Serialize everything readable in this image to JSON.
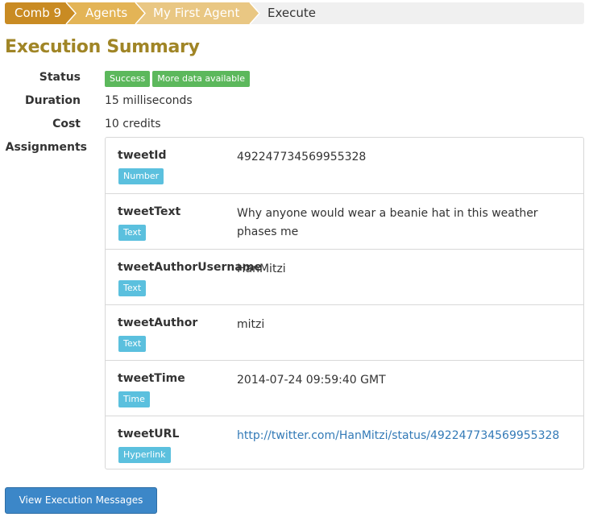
{
  "breadcrumb": {
    "items": [
      {
        "label": "Comb 9",
        "color": "#c98b23"
      },
      {
        "label": "Agents",
        "color": "#e3b456"
      },
      {
        "label": "My First Agent",
        "color": "#e9c783"
      },
      {
        "label": "Execute",
        "color": "#f0f0f0"
      }
    ]
  },
  "page": {
    "title": "Execution Summary"
  },
  "summary": {
    "status_label": "Status",
    "status_badges": [
      "Success",
      "More data available"
    ],
    "duration_label": "Duration",
    "duration_value": "15 milliseconds",
    "cost_label": "Cost",
    "cost_value": "10 credits",
    "assignments_label": "Assignments"
  },
  "assignments": [
    {
      "name": "tweetId",
      "type": "Number",
      "value": "492247734569955328"
    },
    {
      "name": "tweetText",
      "type": "Text",
      "value": "Why anyone would wear a beanie hat in this weather phases me"
    },
    {
      "name": "tweetAuthorUsername",
      "type": "Text",
      "value": "HanMitzi"
    },
    {
      "name": "tweetAuthor",
      "type": "Text",
      "value": "mitzi"
    },
    {
      "name": "tweetTime",
      "type": "Time",
      "value": "2014-07-24 09:59:40 GMT"
    },
    {
      "name": "tweetURL",
      "type": "Hyperlink",
      "value": "http://twitter.com/HanMitzi/status/492247734569955328"
    }
  ],
  "actions": {
    "view_messages_label": "View Execution Messages"
  },
  "colors": {
    "title": "#a08526",
    "success": "#5cb85c",
    "info": "#5bc0de",
    "primary": "#3c87c8",
    "link": "#337ab7"
  }
}
